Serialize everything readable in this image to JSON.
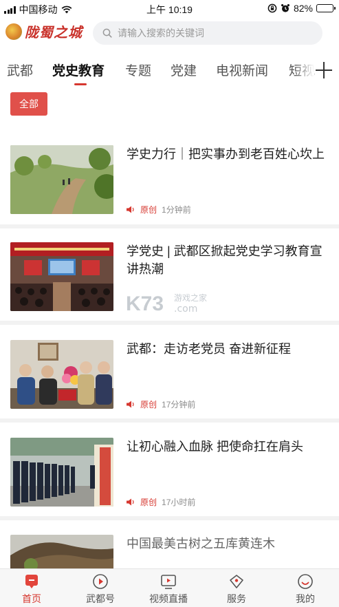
{
  "status_bar": {
    "carrier": "中国移动",
    "time": "上午 10:19",
    "battery_percent": "82%",
    "battery_level": 0.82
  },
  "header": {
    "logo_text": "陇蜀之城",
    "search_placeholder": "请输入搜索的关键词"
  },
  "tabs": {
    "items": [
      "武都",
      "党史教育",
      "专题",
      "党建",
      "电视新闻",
      "短视"
    ],
    "active": "党史教育"
  },
  "filter": {
    "all_label": "全部"
  },
  "news": [
    {
      "title": "学史力行｜把实事办到老百姓心坎上",
      "source": "原创",
      "time": "1分钟前",
      "image": "orchard-hillside-photo"
    },
    {
      "title": "学党史 | 武都区掀起党史学习教育宣讲热潮",
      "source": "",
      "time": "",
      "image": "auditorium-meeting-photo"
    },
    {
      "title": "武都：走访老党员 奋进新征程",
      "source": "原创",
      "time": "17分钟前",
      "image": "visiting-veterans-photo"
    },
    {
      "title": "让初心融入血脉 把使命扛在肩头",
      "source": "原创",
      "time": "17小时前",
      "image": "uniformed-lineup-photo"
    },
    {
      "title": "中国最美古树之五库黄连木",
      "source": "",
      "time": "",
      "image": "ancient-tree-photo"
    }
  ],
  "watermark": {
    "text": "K73",
    "sub_text": "游戏之家",
    "domain": ".com"
  },
  "bottom_nav": [
    {
      "label": "首页",
      "icon": "home-icon",
      "active": true
    },
    {
      "label": "武都号",
      "icon": "play-circle-icon",
      "active": false
    },
    {
      "label": "视频直播",
      "icon": "video-icon",
      "active": false
    },
    {
      "label": "服务",
      "icon": "service-icon",
      "active": false
    },
    {
      "label": "我的",
      "icon": "profile-icon",
      "active": false
    }
  ],
  "colors": {
    "accent": "#d6372f",
    "filter_bg": "#e0504a",
    "search_bg": "#f1f2f4",
    "separator": "#f2f2f2"
  }
}
